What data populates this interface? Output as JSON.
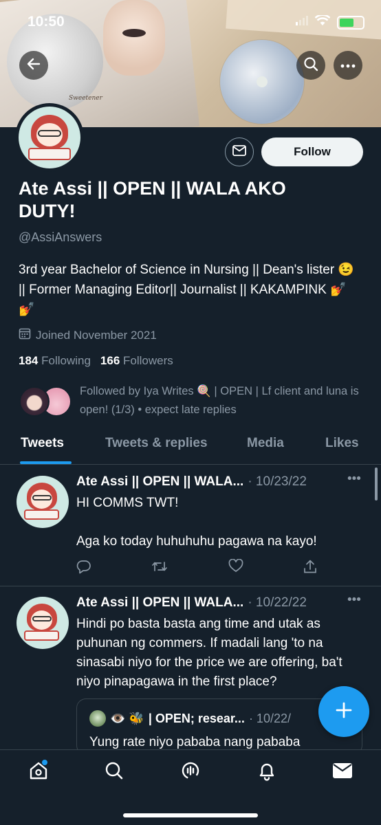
{
  "status_bar": {
    "time": "10:50"
  },
  "banner": {
    "poster_text": "Sweetener"
  },
  "profile": {
    "name": "Ate Assi || OPEN || WALA AKO DUTY!",
    "handle": "@AssiAnswers",
    "bio": "3rd year Bachelor of Science in Nursing || Dean's lister 😉 || Former Managing Editor|| Journalist || KAKAMPINK 💅💅",
    "joined": "Joined November 2021",
    "following_count": "184",
    "following_label": "Following",
    "followers_count": "166",
    "followers_label": "Followers",
    "followed_by": "Followed by Iya Writes 🍭 | OPEN | Lf client and luna is open! (1/3) • expect late replies",
    "follow_label": "Follow"
  },
  "tabs": [
    {
      "label": "Tweets",
      "active": true
    },
    {
      "label": "Tweets & replies"
    },
    {
      "label": "Media"
    },
    {
      "label": "Likes"
    }
  ],
  "tweets": [
    {
      "name": "Ate Assi || OPEN || WALA...",
      "date": "· 10/23/22",
      "text_line1": "HI COMMS TWT!",
      "text_line2": "Aga ko today huhuhuhu pagawa na kayo!"
    },
    {
      "name": "Ate Assi || OPEN || WALA...",
      "date": "· 10/22/22",
      "text": "Hindi po basta basta ang time and utak as puhunan ng commers. If madali lang 'to na sinasabi niyo for the price we are offering, ba't niyo pinapagawa in the first place?",
      "quote": {
        "emojis": "👁️ 🐝",
        "name": "| OPEN; resear...",
        "date": "· 10/22/",
        "text": "Yung rate niyo pababa nang pababa"
      }
    }
  ],
  "colors": {
    "background": "#15202b",
    "accent": "#1d9bf0",
    "muted": "#8b98a5",
    "border": "#38444d"
  },
  "icons": [
    "back-arrow-icon",
    "search-icon",
    "more-icon",
    "mail-icon",
    "calendar-icon",
    "reply-icon",
    "retweet-icon",
    "like-icon",
    "share-icon",
    "compose-plus-icon",
    "home-icon",
    "spaces-icon",
    "bell-icon"
  ]
}
